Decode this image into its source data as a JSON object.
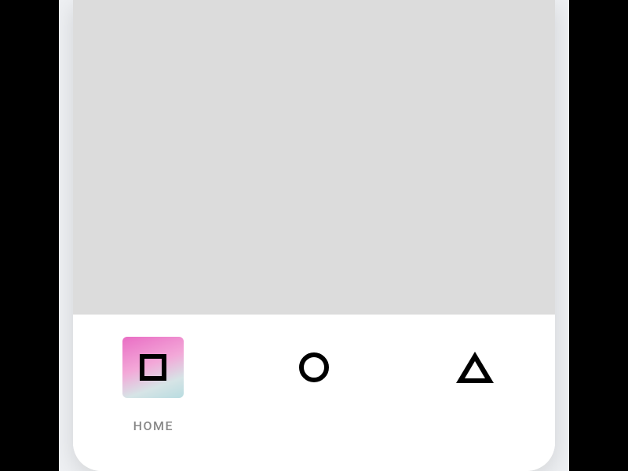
{
  "nav": {
    "items": [
      {
        "label": "HOME",
        "icon": "square",
        "active": true
      },
      {
        "label": "",
        "icon": "circle",
        "active": false
      },
      {
        "label": "",
        "icon": "triangle",
        "active": false
      }
    ]
  }
}
